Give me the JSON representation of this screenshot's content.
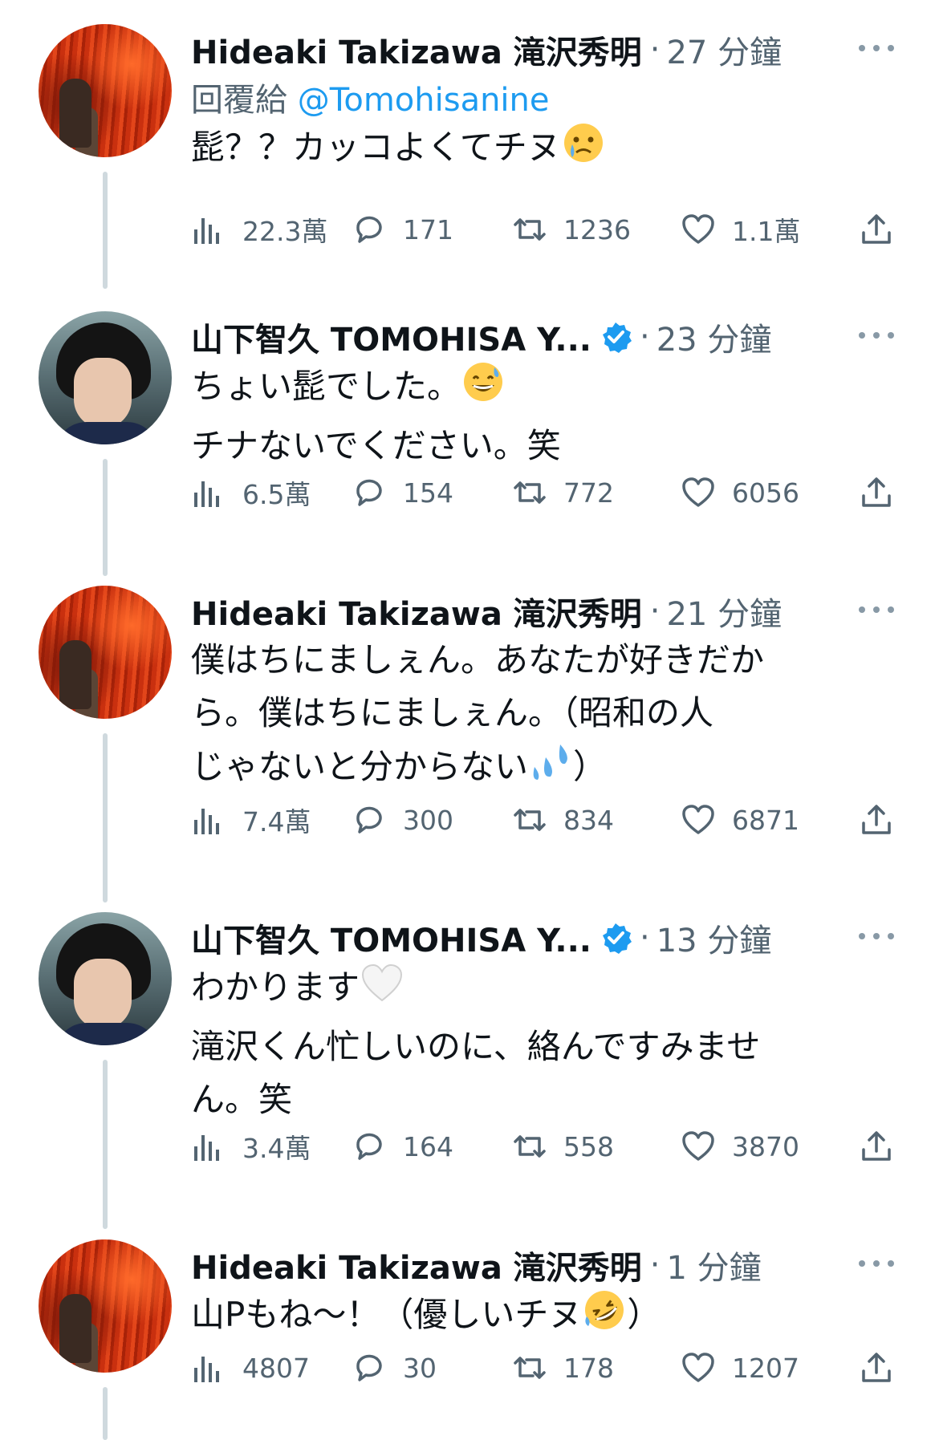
{
  "tweets": [
    {
      "author": "Hideaki Takizawa 滝沢秀明",
      "verified": false,
      "time": "27 分鐘",
      "reply_prefix": "回覆給",
      "reply_handle": "@Tomohisanine",
      "text": "髭？？カッコよくてチヌ",
      "emoji": "crying-face",
      "stats": {
        "views": "22.3萬",
        "replies": "171",
        "retweets": "1236",
        "likes": "1.1萬"
      }
    },
    {
      "author": "山下智久 TOMOHISA Y...",
      "verified": true,
      "time": "23 分鐘",
      "text_line1": "ちょい髭でした。",
      "emoji": "sweat-smile",
      "text_line2": "チナないでください。笑",
      "stats": {
        "views": "6.5萬",
        "replies": "154",
        "retweets": "772",
        "likes": "6056"
      }
    },
    {
      "author": "Hideaki Takizawa 滝沢秀明",
      "verified": false,
      "time": "21 分鐘",
      "text_line1": "僕はちにましぇん。あなたが好きだか",
      "text_line2": "ら。僕はちにましぇん。（昭和の人",
      "text_line3a": "じゃないと分からない",
      "emoji": "sweat-droplets",
      "text_line3b": "）",
      "stats": {
        "views": "7.4萬",
        "replies": "300",
        "retweets": "834",
        "likes": "6871"
      }
    },
    {
      "author": "山下智久 TOMOHISA Y...",
      "verified": true,
      "time": "13 分鐘",
      "text_line1": "わかります",
      "emoji": "white-heart",
      "text_line2": "滝沢くん忙しいのに、絡んですみませ",
      "text_line3": "ん。笑",
      "stats": {
        "views": "3.4萬",
        "replies": "164",
        "retweets": "558",
        "likes": "3870"
      }
    },
    {
      "author": "Hideaki Takizawa 滝沢秀明",
      "verified": false,
      "time": "1 分鐘",
      "text_a": "山Pもね～！（優しいチヌ",
      "emoji": "rofl-face",
      "text_b": "）",
      "stats": {
        "views": "4807",
        "replies": "30",
        "retweets": "178",
        "likes": "1207"
      }
    }
  ],
  "colors": {
    "text": "#0f1419",
    "secondary": "#536471",
    "link": "#1d9bf0",
    "thread_line": "#cfd9de"
  }
}
